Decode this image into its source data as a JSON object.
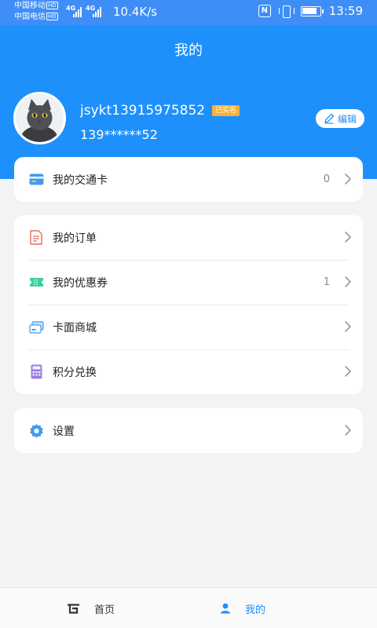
{
  "status_bar": {
    "carrier_1": "中国移动",
    "carrier_2": "中国电信",
    "hd_badge": "HD",
    "network_speed": "10.4K/s",
    "nfc_label": "N",
    "time": "13:59"
  },
  "header": {
    "title": "我的",
    "username": "jsykt13915975852",
    "verified_badge": "已实名",
    "phone": "139******52",
    "edit_label": "编辑"
  },
  "menu_cards": [
    {
      "items": [
        {
          "icon": "transit-card-icon",
          "label": "我的交通卡",
          "count": "0"
        }
      ]
    },
    {
      "items": [
        {
          "icon": "order-icon",
          "label": "我的订单",
          "count": ""
        },
        {
          "icon": "coupon-icon",
          "label": "我的优惠券",
          "count": "1"
        },
        {
          "icon": "card-store-icon",
          "label": "卡面商城",
          "count": ""
        },
        {
          "icon": "points-exchange-icon",
          "label": "积分兑换",
          "count": ""
        }
      ]
    },
    {
      "items": [
        {
          "icon": "settings-icon",
          "label": "设置",
          "count": ""
        }
      ]
    }
  ],
  "tab_bar": {
    "home_label": "首页",
    "mine_label": "我的"
  },
  "colors": {
    "primary": "#1e90fb",
    "status_bar": "#3f8ef7",
    "background": "#f2f3f5",
    "badge": "#f6b23a"
  }
}
